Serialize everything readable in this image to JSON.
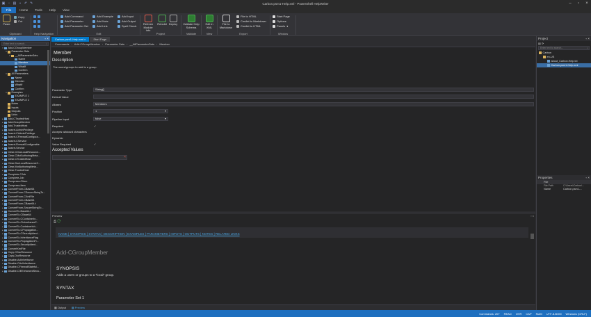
{
  "app": {
    "title": "Carbon.psm1-Help.xml - PowerShell HelpWriter"
  },
  "menu": [
    "File",
    "Home",
    "Tools",
    "Help",
    "View"
  ],
  "ribbon": {
    "clipboard": {
      "label": "Clipboard",
      "paste": "Paste",
      "copy": "Copy",
      "cut": "Cut"
    },
    "help_nav": {
      "label": "Help Navigation"
    },
    "edit": {
      "label": "Edit",
      "add_command": "Add Command",
      "add_parameter": "Add Parameter",
      "add_parameter_set": "Add Parameter Set",
      "add_example": "Add Example",
      "add_note": "Add Note",
      "add_link": "Add Link",
      "add_input": "Add Input",
      "add_output": "Add Output",
      "spell_check": "Spell Check"
    },
    "project": {
      "label": "Project",
      "refresh": "Refresh Module Info",
      "rebuild": "Rebuild",
      "deploy": "Deploy"
    },
    "validate": {
      "label": "Validate",
      "validate_schema": "Validate Help Schema"
    },
    "view": {
      "label": "View",
      "edit_xml": "Edit in XML"
    },
    "export": {
      "label": "Export",
      "file_to_markdown": "File to Markdown",
      "file_to_html": "File to HTML",
      "cmdlet_to_markdown": "Cmdlet to Markdown",
      "cmdlet_to_html": "Cmdlet to HTML"
    },
    "window": {
      "label": "Window",
      "start_page": "Start Page",
      "options": "Options",
      "panels": "Panels"
    }
  },
  "navigation": {
    "title": "Navigation",
    "search_placeholder": "Enter text to search...",
    "items": [
      {
        "label": "Add-CGroupMember",
        "depth": 0,
        "arrow": "▾",
        "icon": "doc"
      },
      {
        "label": "Parameter Sets",
        "depth": 1,
        "arrow": "▾",
        "icon": "fold"
      },
      {
        "label": "__AllParameterSets",
        "depth": 2,
        "arrow": "▾",
        "icon": "fold"
      },
      {
        "label": "Name",
        "depth": 3,
        "icon": "doc"
      },
      {
        "label": "Member",
        "depth": 3,
        "icon": "doc",
        "selected": true
      },
      {
        "label": "WhatIf",
        "depth": 3,
        "icon": "doc"
      },
      {
        "label": "Confirm",
        "depth": 3,
        "icon": "doc"
      },
      {
        "label": "All Parameters",
        "depth": 1,
        "arrow": "▾",
        "icon": "fold"
      },
      {
        "label": "Name",
        "depth": 2,
        "icon": "doc"
      },
      {
        "label": "Member",
        "depth": 2,
        "icon": "doc"
      },
      {
        "label": "WhatIf",
        "depth": 2,
        "icon": "doc"
      },
      {
        "label": "Confirm",
        "depth": 2,
        "icon": "doc"
      },
      {
        "label": "Examples",
        "depth": 1,
        "arrow": "▾",
        "icon": "fold"
      },
      {
        "label": "EXAMPLE 1",
        "depth": 2,
        "icon": "doc"
      },
      {
        "label": "EXAMPLE 2",
        "depth": 2,
        "icon": "doc"
      },
      {
        "label": "Notes",
        "depth": 1,
        "icon": "fold"
      },
      {
        "label": "Inputs",
        "depth": 1,
        "icon": "fold"
      },
      {
        "label": "Outputs",
        "depth": 1,
        "icon": "fold"
      },
      {
        "label": "Links",
        "depth": 1,
        "icon": "fold"
      },
      {
        "label": "Add-CTrustedHost",
        "depth": 0,
        "arrow": "▸",
        "icon": "doc"
      },
      {
        "label": "Add-GroupMember",
        "depth": 0,
        "arrow": "▸",
        "icon": "doc"
      },
      {
        "label": "Add-TrustedHost",
        "depth": 0,
        "arrow": "▸",
        "icon": "doc"
      },
      {
        "label": "Assert-AdminPrivilege",
        "depth": 0,
        "arrow": "▸",
        "icon": "doc"
      },
      {
        "label": "Assert-CAdminPrivilege",
        "depth": 0,
        "arrow": "▸",
        "icon": "doc"
      },
      {
        "label": "Assert-CFirewallConfigura...",
        "depth": 0,
        "arrow": "▸",
        "icon": "doc"
      },
      {
        "label": "Assert-CService",
        "depth": 0,
        "arrow": "▸",
        "icon": "doc"
      },
      {
        "label": "Assert-FirewallConfigurable",
        "depth": 0,
        "arrow": "▸",
        "icon": "doc"
      },
      {
        "label": "Assert-Service",
        "depth": 0,
        "arrow": "▸",
        "icon": "doc"
      },
      {
        "label": "Clear-CDscLocalResource...",
        "depth": 0,
        "arrow": "▸",
        "icon": "doc"
      },
      {
        "label": "Clear-CMofAuthoringMeta...",
        "depth": 0,
        "arrow": "▸",
        "icon": "doc"
      },
      {
        "label": "Clear-CTrustedHost",
        "depth": 0,
        "arrow": "▸",
        "icon": "doc"
      },
      {
        "label": "Clear-DscLocalResourceC...",
        "depth": 0,
        "arrow": "▸",
        "icon": "doc"
      },
      {
        "label": "Clear-MofAuthoringMeta...",
        "depth": 0,
        "arrow": "▸",
        "icon": "doc"
      },
      {
        "label": "Clear-TrustedHost",
        "depth": 0,
        "arrow": "▸",
        "icon": "doc"
      },
      {
        "label": "Complete-CJob",
        "depth": 0,
        "arrow": "▸",
        "icon": "doc"
      },
      {
        "label": "Complete-Job",
        "depth": 0,
        "arrow": "▸",
        "icon": "doc"
      },
      {
        "label": "Compress-CItem",
        "depth": 0,
        "arrow": "▸",
        "icon": "doc"
      },
      {
        "label": "Compress-Item",
        "depth": 0,
        "arrow": "▸",
        "icon": "doc"
      },
      {
        "label": "ConvertFrom-CBase64",
        "depth": 0,
        "arrow": "▸",
        "icon": "doc"
      },
      {
        "label": "ConvertFrom-CSecureStringTo...",
        "depth": 0,
        "arrow": "▸",
        "icon": "doc"
      },
      {
        "label": "ConvertFrom-CXmlFile",
        "depth": 0,
        "arrow": "▸",
        "icon": "doc"
      },
      {
        "label": "ConvertFrom-CBase64",
        "depth": 0,
        "arrow": "▸",
        "icon": "doc"
      },
      {
        "label": "ConvertFrom-CBase64-t",
        "depth": 0,
        "arrow": "▸",
        "icon": "doc"
      },
      {
        "label": "ConvertFrom-SecureStringTo...",
        "depth": 0,
        "arrow": "▸",
        "icon": "doc"
      },
      {
        "label": "ConvertTo-Base64-t",
        "depth": 0,
        "arrow": "▸",
        "icon": "doc"
      },
      {
        "label": "ConvertTo-CBase64",
        "depth": 0,
        "arrow": "▸",
        "icon": "doc"
      },
      {
        "label": "ConvertTo-CContainerIn...",
        "depth": 0,
        "arrow": "▸",
        "icon": "doc"
      },
      {
        "label": "ConvertTo-CInheritanceF...",
        "depth": 0,
        "arrow": "▸",
        "icon": "doc"
      },
      {
        "label": "ConvertTo-ContainerInh...",
        "depth": 0,
        "arrow": "▸",
        "icon": "doc"
      },
      {
        "label": "ConvertTo-CPropagation...",
        "depth": 0,
        "arrow": "▸",
        "icon": "doc"
      },
      {
        "label": "ConvertTo-CSecurityIdent...",
        "depth": 0,
        "arrow": "▸",
        "icon": "doc"
      },
      {
        "label": "ConvertTo-InheritanceFlag",
        "depth": 0,
        "arrow": "▸",
        "icon": "doc"
      },
      {
        "label": "ConvertTo-PropagationFl...",
        "depth": 0,
        "arrow": "▸",
        "icon": "doc"
      },
      {
        "label": "ConvertTo-SecurityIdent...",
        "depth": 0,
        "arrow": "▸",
        "icon": "doc"
      },
      {
        "label": "ConvertXmlFile",
        "depth": 0,
        "arrow": "▸",
        "icon": "doc"
      },
      {
        "label": "Copy-CDscResource",
        "depth": 0,
        "arrow": "▸",
        "icon": "doc"
      },
      {
        "label": "Copy-DscResource",
        "depth": 0,
        "arrow": "▸",
        "icon": "doc"
      },
      {
        "label": "Disable-AclInheritance",
        "depth": 0,
        "arrow": "▸",
        "icon": "doc"
      },
      {
        "label": "Disable-CAclInheritance",
        "depth": 0,
        "arrow": "▸",
        "icon": "doc"
      },
      {
        "label": "Disable-CFirewallStateful...",
        "depth": 0,
        "arrow": "▸",
        "icon": "doc"
      },
      {
        "label": "Disable-CIEEnhancedSecu...",
        "depth": 0,
        "arrow": "▸",
        "icon": "doc"
      }
    ]
  },
  "tabs": [
    {
      "label": "Carbon.psm1-Help.xml",
      "active": true
    },
    {
      "label": "Start Page",
      "active": false
    }
  ],
  "breadcrumbs": [
    "Commands",
    "Add-CGroupMember",
    "Parameter Sets",
    "__AllParameterSets",
    "Member"
  ],
  "editor": {
    "heading": "Member",
    "description_label": "Description",
    "description": "The users/groups to add to a group.",
    "fields": [
      {
        "label": "Parameter Type",
        "value": "String[]"
      },
      {
        "label": "Default Value",
        "value": ""
      },
      {
        "label": "Aliases",
        "value": "Members"
      },
      {
        "label": "Position",
        "value": "1"
      },
      {
        "label": "Pipeline Input",
        "value": "false"
      }
    ],
    "checks": [
      {
        "label": "Required",
        "checked": true
      },
      {
        "label": "Accepts wildcard characters",
        "checked": false
      },
      {
        "label": "Dynamic",
        "checked": false
      },
      {
        "label": "Value Required",
        "checked": true
      }
    ],
    "accepted_label": "Accepted Values"
  },
  "preview": {
    "title": "Preview",
    "links": "NAME | SYNOPSIS | SYNTAX | DESCRIPTION | EXAMPLES | PARAMETERS | INPUTS | OUTPUTS | NOTES | RELATED LINKS",
    "command": "Add-CGroupMember",
    "synopsis_h": "SYNOPSIS",
    "synopsis": "Adds a users or groups to a *local* group.",
    "syntax_h": "SYNTAX",
    "paramset_h": "Parameter Set 1"
  },
  "bottom_tabs": [
    "Output",
    "Preview"
  ],
  "project": {
    "title": "Project",
    "search_placeholder": "Enter text to search...",
    "items": [
      {
        "label": "Carbon",
        "depth": 0
      },
      {
        "label": "en-US",
        "depth": 1
      },
      {
        "label": "about_Carbon.Help.txt",
        "depth": 2
      },
      {
        "label": "Carbon.psm1-Help.xml",
        "depth": 2,
        "selected": true
      }
    ]
  },
  "properties": {
    "title": "Properties",
    "section": "File",
    "col1": "File Path",
    "col2": "C:\\Users\\Carbon\\...",
    "name_label": "Name",
    "name_value": "Carbon.psm1-..."
  },
  "status": [
    "Commands: 207",
    "READ",
    "OVR",
    "CAP",
    "NUM",
    "UTF-8-BOM",
    "Windows (CRLF)"
  ]
}
